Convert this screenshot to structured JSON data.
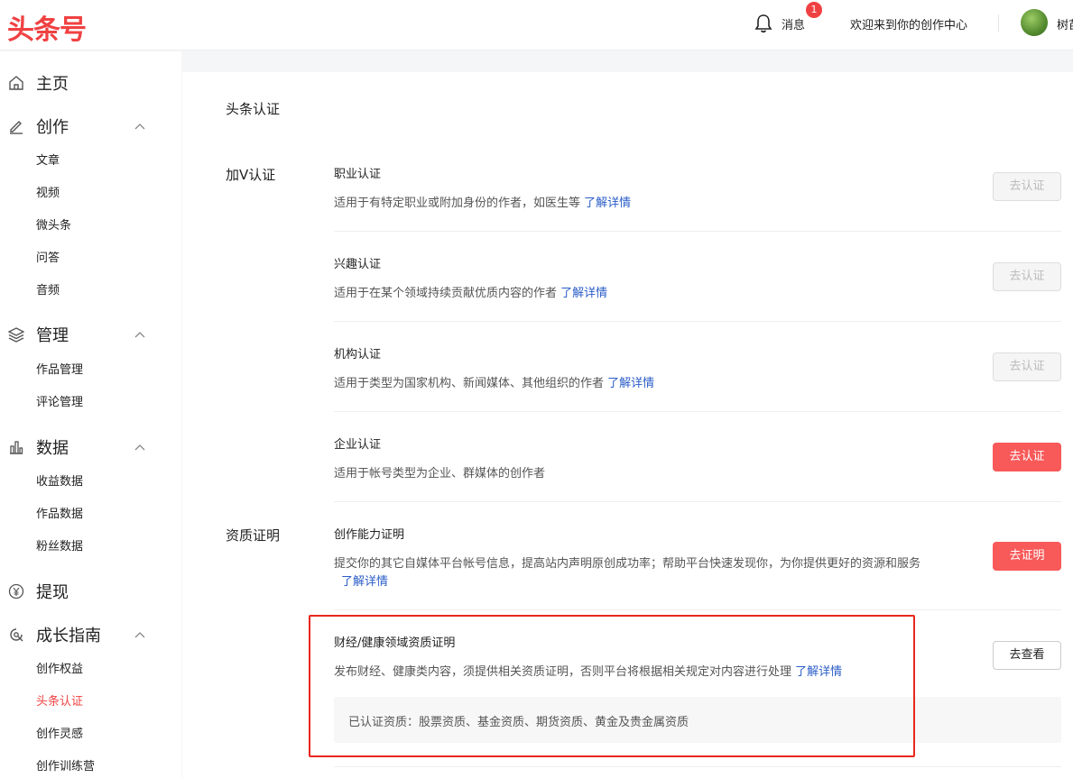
{
  "header": {
    "logo": "头条号",
    "messages_label": "消息",
    "messages_badge": "1",
    "welcome": "欢迎来到你的创作中心",
    "username": "树苗"
  },
  "sidebar": {
    "home": "主页",
    "create": {
      "label": "创作",
      "items": [
        "文章",
        "视频",
        "微头条",
        "问答",
        "音频"
      ]
    },
    "manage": {
      "label": "管理",
      "items": [
        "作品管理",
        "评论管理"
      ]
    },
    "data": {
      "label": "数据",
      "items": [
        "收益数据",
        "作品数据",
        "粉丝数据"
      ]
    },
    "withdraw": "提现",
    "growth": {
      "label": "成长指南",
      "items": [
        "创作权益",
        "头条认证",
        "创作灵感",
        "创作训练营"
      ]
    }
  },
  "main": {
    "title": "头条认证",
    "v_section": "加V认证",
    "qual_section": "资质证明",
    "learn_more": "了解详情",
    "items": [
      {
        "title": "职业认证",
        "desc": "适用于有特定职业或附加身份的作者，如医生等",
        "button": "去认证",
        "state": "disabled"
      },
      {
        "title": "兴趣认证",
        "desc": "适用于在某个领域持续贡献优质内容的作者",
        "button": "去认证",
        "state": "disabled"
      },
      {
        "title": "机构认证",
        "desc": "适用于类型为国家机构、新闻媒体、其他组织的作者",
        "button": "去认证",
        "state": "disabled"
      },
      {
        "title": "企业认证",
        "desc": "适用于帐号类型为企业、群媒体的创作者",
        "button": "去认证",
        "state": "active"
      },
      {
        "title": "创作能力证明",
        "desc": "提交你的其它自媒体平台帐号信息，提高站内声明原创成功率；帮助平台快速发现你，为你提供更好的资源和服务",
        "button": "去证明",
        "state": "active"
      },
      {
        "title": "财经/健康领域资质证明",
        "desc": "发布财经、健康类内容，须提供相关资质证明，否则平台将根据相关规定对内容进行处理",
        "button": "去查看",
        "state": "outline"
      }
    ],
    "certified_qualifications": "已认证资质：股票资质、基金资质、期货资质、黄金及贵金属资质"
  },
  "colors": {
    "brand": "#f04142",
    "button_red": "#f85959",
    "link": "#2a5cc8",
    "highlight": "#e8271f"
  }
}
